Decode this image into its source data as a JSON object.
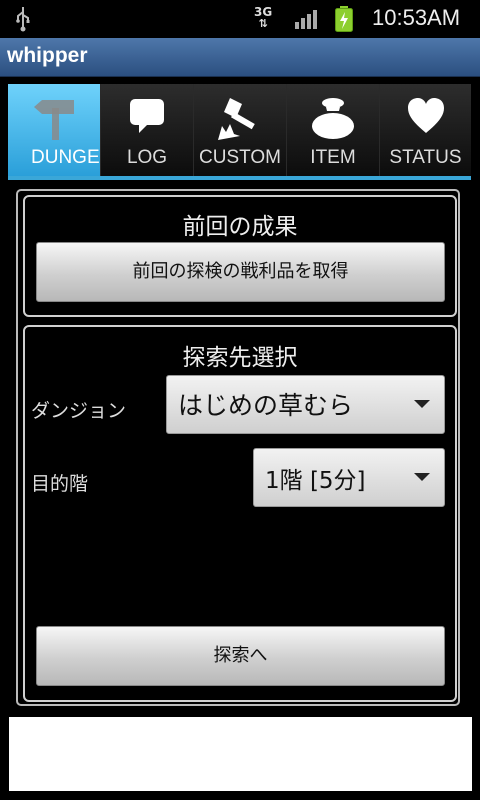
{
  "status_bar": {
    "time": "10:53AM",
    "network": "3G",
    "icons": [
      "usb-icon",
      "network-3g-icon",
      "signal-icon",
      "battery-charging-icon"
    ]
  },
  "app": {
    "title": "whipper"
  },
  "tabs": [
    {
      "label": "DUNGE",
      "icon": "signpost-icon",
      "active": true
    },
    {
      "label": "LOG",
      "icon": "speech-bubble-icon",
      "active": false
    },
    {
      "label": "CUSTOM",
      "icon": "hammer-icon",
      "active": false
    },
    {
      "label": "ITEM",
      "icon": "bag-icon",
      "active": false
    },
    {
      "label": "STATUS",
      "icon": "heart-icon",
      "active": false
    }
  ],
  "previous": {
    "title": "前回の成果",
    "button_label": "前回の探検の戦利品を取得"
  },
  "explore": {
    "title": "探索先選択",
    "dungeon_label": "ダンジョン",
    "dungeon_value": "はじめの草むら",
    "floor_label": "目的階",
    "floor_value": "1階 [5分]",
    "go_button_label": "探索へ"
  },
  "colors": {
    "accent": "#3aa7d8",
    "titlebar": "#3a6192",
    "tab_active": "#4cbaf0"
  }
}
